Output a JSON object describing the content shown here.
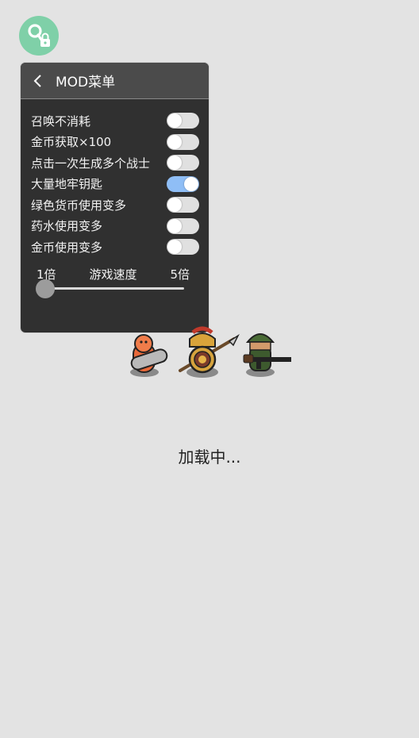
{
  "fab": {
    "icon": "key-lock-icon"
  },
  "menu": {
    "title": "MOD菜单",
    "back_icon": "chevron-left-icon",
    "options": [
      {
        "label": "召唤不消耗",
        "on": false
      },
      {
        "label": "金币获取×100",
        "on": false
      },
      {
        "label": "点击一次生成多个战士",
        "on": false
      },
      {
        "label": "大量地牢钥匙",
        "on": true
      },
      {
        "label": "绿色货币使用变多",
        "on": false
      },
      {
        "label": "药水使用变多",
        "on": false
      },
      {
        "label": "金币使用变多",
        "on": false
      }
    ],
    "speed": {
      "min_label": "1倍",
      "title": "游戏速度",
      "max_label": "5倍",
      "value": 1
    }
  },
  "colors": {
    "accent": "#8fbef6",
    "fab": "#7fd0a8",
    "panel": "#303030"
  },
  "loading_text": "加载中..."
}
